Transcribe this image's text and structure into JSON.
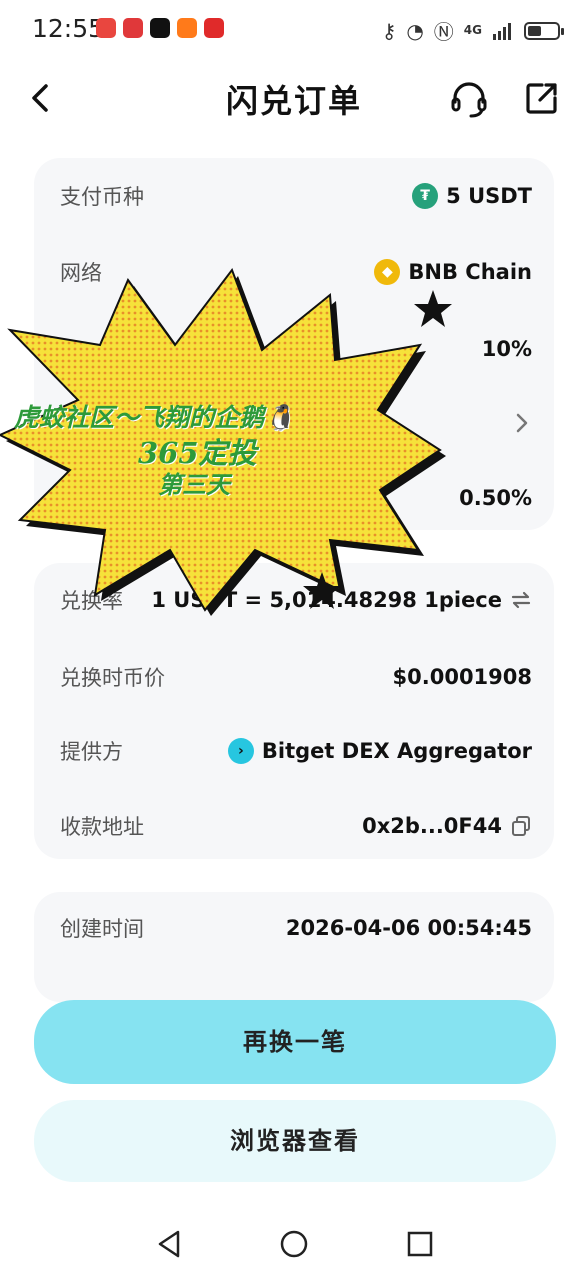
{
  "status_bar": {
    "time": "12:55",
    "network": "4G",
    "battery_level": 0.45,
    "app_icons": [
      {
        "name": "xiaohongshu-app-icon",
        "color": "#e9463f"
      },
      {
        "name": "red-app-icon",
        "color": "#e0383a"
      },
      {
        "name": "tiktok-app-icon",
        "color": "#111111"
      },
      {
        "name": "taobao-app-icon",
        "color": "#ff7a1a"
      },
      {
        "name": "pdd-app-icon",
        "color": "#e02a2a"
      }
    ]
  },
  "header": {
    "title": "闪兑订单"
  },
  "order": {
    "pay_label": "支付币种",
    "pay_value": "5 USDT",
    "network_label": "网络",
    "network_value": "BNB Chain",
    "slippage_value": "10%",
    "fee_value": "0.50%"
  },
  "details": {
    "rate_label": "兑换率",
    "rate_value": "1 USDT = 5,014.48298 1piece",
    "price_label": "兑换时币价",
    "price_value": "$0.0001908",
    "provider_label": "提供方",
    "provider_value": "Bitget DEX Aggregator",
    "address_label": "收款地址",
    "address_value": "0x2b...0F44"
  },
  "meta": {
    "created_label": "创建时间",
    "created_value": "2026-04-06 00:54:45"
  },
  "actions": {
    "again_label": "再换一笔",
    "explorer_label": "浏览器查看"
  },
  "sticker": {
    "line1": "虎蛟社区～飞翔的企鹅",
    "line2": "365定投",
    "line3": "第三天",
    "penguin_glyph": "🐧"
  },
  "colors": {
    "accent": "#86e3f1",
    "secondary": "#e8f9fb",
    "card_bg": "#f6f7f9",
    "usdt": "#26a17b",
    "bnb": "#f0b90b",
    "bitget": "#27c6e0",
    "sticker_yellow": "#f6e23a",
    "sticker_text": "#2d9a3a"
  }
}
